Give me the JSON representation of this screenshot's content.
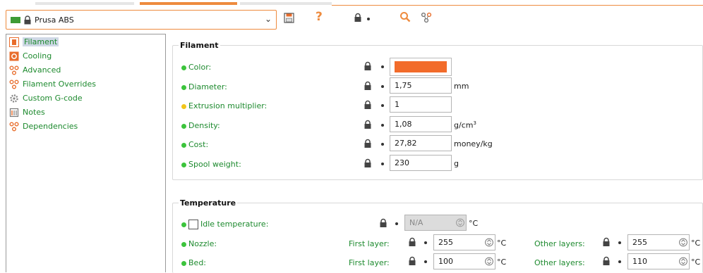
{
  "preset": {
    "name": "Prusa ABS"
  },
  "colors": {
    "accent": "#ee8b3e",
    "green": "#1d8a2e",
    "filament_swatch": "#f26b2a"
  },
  "toolbar_icons": [
    "save-icon",
    "question-icon",
    "lock-icon",
    "search-icon",
    "compare-icon"
  ],
  "sidebar": {
    "items": [
      {
        "label": "Filament",
        "icon": "filament-icon"
      },
      {
        "label": "Cooling",
        "icon": "cooling-icon"
      },
      {
        "label": "Advanced",
        "icon": "advanced-icon"
      },
      {
        "label": "Filament Overrides",
        "icon": "overrides-icon"
      },
      {
        "label": "Custom G-code",
        "icon": "gcode-icon"
      },
      {
        "label": "Notes",
        "icon": "notes-icon"
      },
      {
        "label": "Dependencies",
        "icon": "dependencies-icon"
      }
    ]
  },
  "filament": {
    "title": "Filament",
    "color_label": "Color:",
    "diameter": {
      "label": "Diameter:",
      "value": "1,75",
      "unit": "mm"
    },
    "extrusion": {
      "label": "Extrusion multiplier:",
      "value": "1"
    },
    "density": {
      "label": "Density:",
      "value": "1,08",
      "unit": "g/cm",
      "unit_sup": "3"
    },
    "cost": {
      "label": "Cost:",
      "value": "27,82",
      "unit": "money/kg"
    },
    "spool": {
      "label": "Spool weight:",
      "value": "230",
      "unit": "g"
    }
  },
  "temperature": {
    "title": "Temperature",
    "idle": {
      "label": "Idle temperature:",
      "value": "N/A",
      "unit": "°C"
    },
    "nozzle": {
      "label": "Nozzle:",
      "first_label": "First layer:",
      "first_value": "255",
      "other_label": "Other layers:",
      "other_value": "255",
      "unit": "°C"
    },
    "bed": {
      "label": "Bed:",
      "first_label": "First layer:",
      "first_value": "100",
      "other_label": "Other layers:",
      "other_value": "110",
      "unit": "°C"
    }
  }
}
